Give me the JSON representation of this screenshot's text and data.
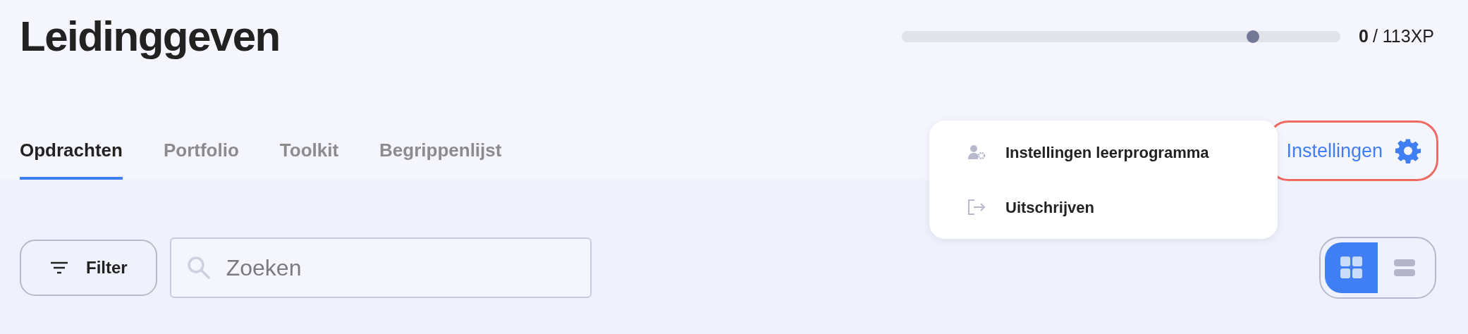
{
  "page": {
    "title": "Leidinggeven"
  },
  "progress": {
    "level": 0.8,
    "earned": "0",
    "total": "/ 113XP"
  },
  "tabs": [
    {
      "label": "Opdrachten",
      "selected": true
    },
    {
      "label": "Portfolio",
      "selected": false
    },
    {
      "label": "Toolkit",
      "selected": false
    },
    {
      "label": "Begrippenlijst",
      "selected": false
    }
  ],
  "settings_button": {
    "label": "Instellingen",
    "expanded": true
  },
  "settings_menu": [
    {
      "kind": "user-settings",
      "label": "Instellingen leerprogramma"
    },
    {
      "kind": "sign-out",
      "label": "Uitschrijven"
    }
  ],
  "filter_button": {
    "label": "Filter"
  },
  "search": {
    "placeholder": "Zoeken"
  },
  "view_toggle": [
    {
      "kind": "grid",
      "selected": true
    },
    {
      "kind": "list",
      "selected": false
    }
  ]
}
